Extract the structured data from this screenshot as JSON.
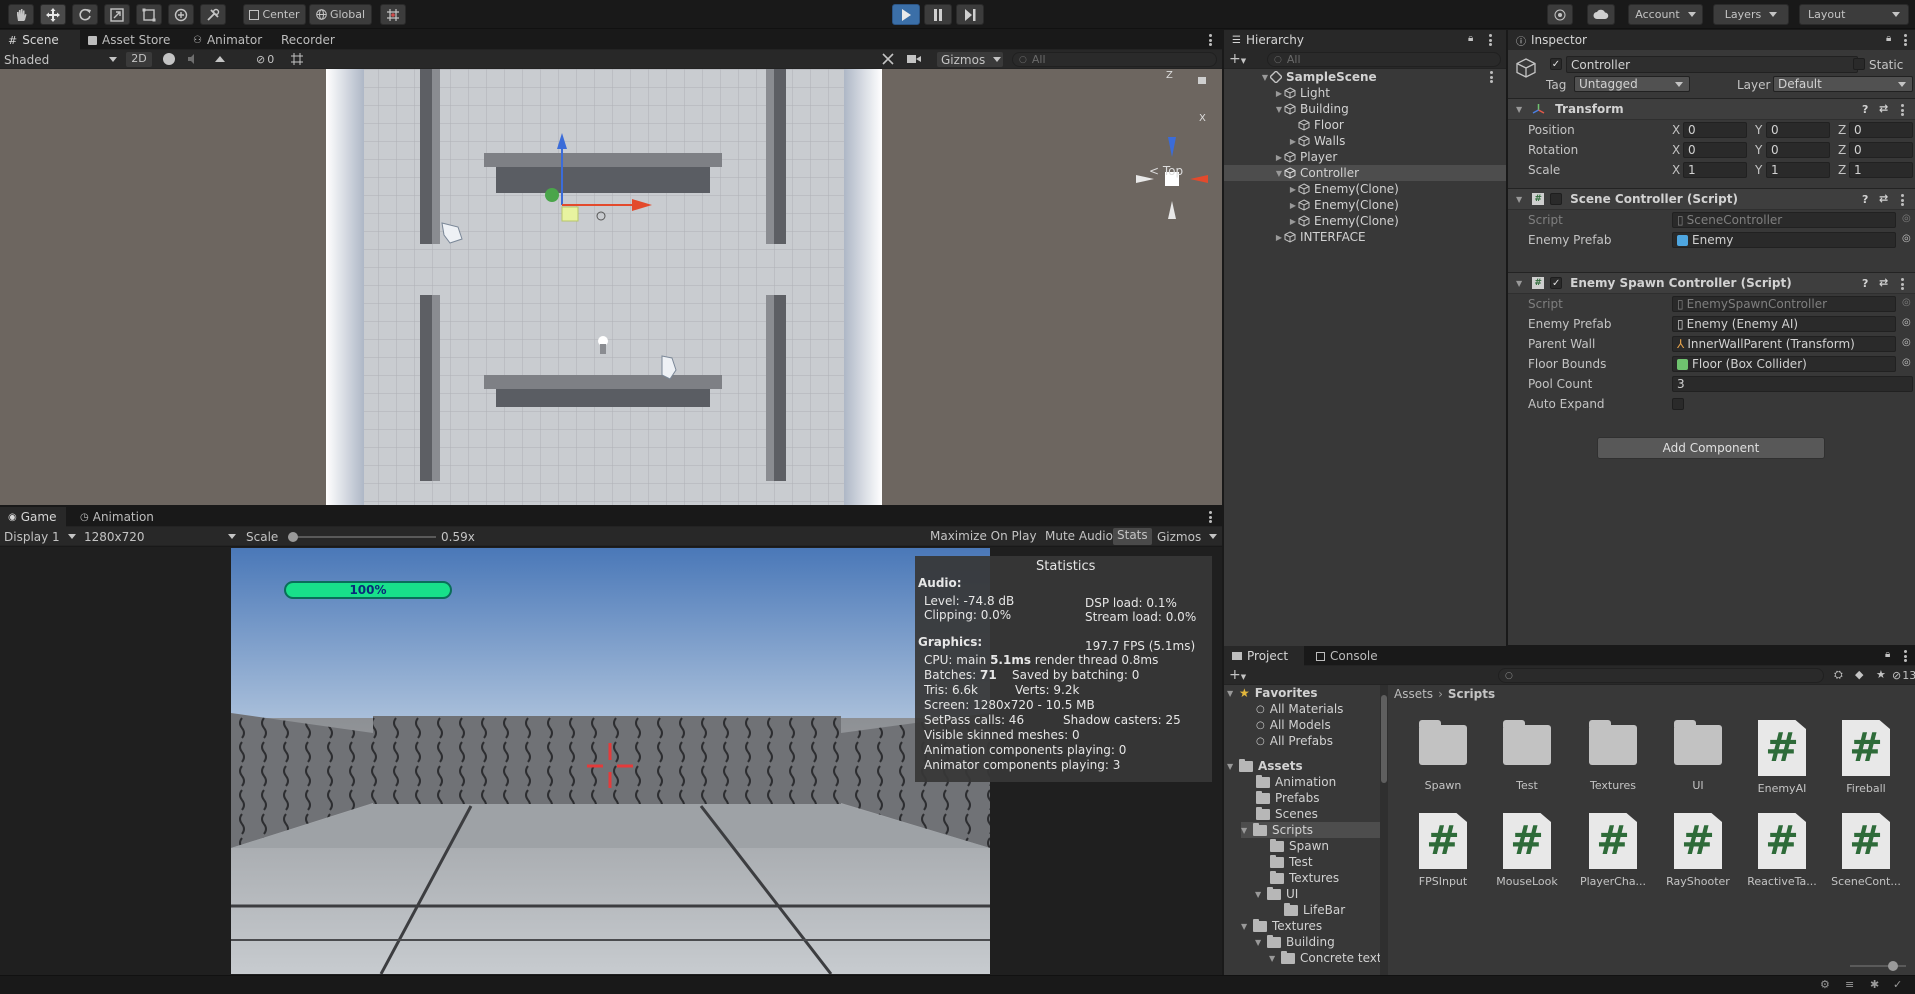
{
  "toolbar": {
    "pivot": "Center",
    "space": "Global",
    "account": "Account",
    "layers": "Layers",
    "layout": "Layout"
  },
  "scene_tabs": [
    "Scene",
    "Asset Store",
    "Animator",
    "Recorder"
  ],
  "scene_bar": {
    "shading": "Shaded",
    "mode_2d": "2D",
    "hidden_count": "0",
    "gizmos": "Gizmos",
    "search_placeholder": "All"
  },
  "gizmo_labels": {
    "z": "Z",
    "x": "X",
    "view": "< Top"
  },
  "game_tabs": [
    "Game",
    "Animation"
  ],
  "game_bar": {
    "display": "Display 1",
    "resolution": "1280x720",
    "scale_label": "Scale",
    "scale_value": "0.59x",
    "scale_fraction": 0.0,
    "maximize": "Maximize On Play",
    "mute": "Mute Audio",
    "stats": "Stats",
    "gizmos": "Gizmos"
  },
  "game": {
    "health_text": "100%",
    "health_fraction": 1.0,
    "health_color": "#18e08a"
  },
  "stats": {
    "title": "Statistics",
    "audio_header": "Audio:",
    "level": "Level: -74.8 dB",
    "dsp": "DSP load: 0.1%",
    "clipping": "Clipping: 0.0%",
    "stream": "Stream load: 0.0%",
    "graphics_header": "Graphics:",
    "fps": "197.7 FPS (5.1ms)",
    "cpu_prefix": "CPU: main ",
    "cpu_main": "5.1ms",
    "cpu_suffix": "  render thread 0.8ms",
    "batches_prefix": "Batches: ",
    "batches": "71",
    "saved": "Saved by batching: 0",
    "tris": "Tris: 6.6k",
    "verts": "Verts: 9.2k",
    "screen": "Screen: 1280x720 - 10.5 MB",
    "setpass": "SetPass calls: 46",
    "shadow": "Shadow casters: 25",
    "skinned": "Visible skinned meshes: 0",
    "anim": "Animation components playing: 0",
    "animator": "Animator components playing: 3"
  },
  "hierarchy": {
    "tab": "Hierarchy",
    "search_placeholder": "All",
    "scene": "SampleScene",
    "items": [
      "Light",
      "Building",
      "Floor",
      "Walls",
      "Player",
      "Controller",
      "Enemy(Clone)",
      "Enemy(Clone)",
      "Enemy(Clone)",
      "INTERFACE"
    ]
  },
  "inspector": {
    "tab": "Inspector",
    "object_name": "Controller",
    "static_label": "Static",
    "tag_label": "Tag",
    "tag_value": "Untagged",
    "layer_label": "Layer",
    "layer_value": "Default",
    "transform": {
      "title": "Transform",
      "position": "Position",
      "rotation": "Rotation",
      "scale": "Scale",
      "pos": [
        "0",
        "0",
        "0"
      ],
      "rot": [
        "0",
        "0",
        "0"
      ],
      "scl": [
        "1",
        "1",
        "1"
      ]
    },
    "scene_controller": {
      "title": "Scene Controller (Script)",
      "script_label": "Script",
      "script_value": "SceneController",
      "prefab_label": "Enemy Prefab",
      "prefab_value": "Enemy"
    },
    "spawn_controller": {
      "title": "Enemy Spawn Controller (Script)",
      "script_label": "Script",
      "script_value": "EnemySpawnController",
      "prefab_label": "Enemy Prefab",
      "prefab_value": "Enemy (Enemy AI)",
      "wall_label": "Parent Wall",
      "wall_value": "InnerWallParent (Transform)",
      "bounds_label": "Floor Bounds",
      "bounds_value": "Floor (Box Collider)",
      "pool_label": "Pool Count",
      "pool_value": "3",
      "expand_label": "Auto Expand"
    },
    "add_component": "Add Component"
  },
  "project": {
    "tabs": [
      "Project",
      "Console"
    ],
    "hidden_count": "13",
    "breadcrumb": [
      "Assets",
      "Scripts"
    ],
    "favorites": "Favorites",
    "fav_items": [
      "All Materials",
      "All Models",
      "All Prefabs"
    ],
    "assets": "Assets",
    "tree": [
      "Animation",
      "Prefabs",
      "Scenes",
      "Scripts",
      "Spawn",
      "Test",
      "Textures",
      "UI",
      "LifeBar",
      "Textures",
      "Building",
      "Concrete texti"
    ],
    "folders": [
      "Spawn",
      "Test",
      "Textures",
      "UI"
    ],
    "scripts_row1": [
      "EnemyAI",
      "Fireball"
    ],
    "scripts_row2": [
      "FPSInput",
      "MouseLook",
      "PlayerCha...",
      "RayShooter",
      "ReactiveTa...",
      "SceneCont..."
    ]
  }
}
